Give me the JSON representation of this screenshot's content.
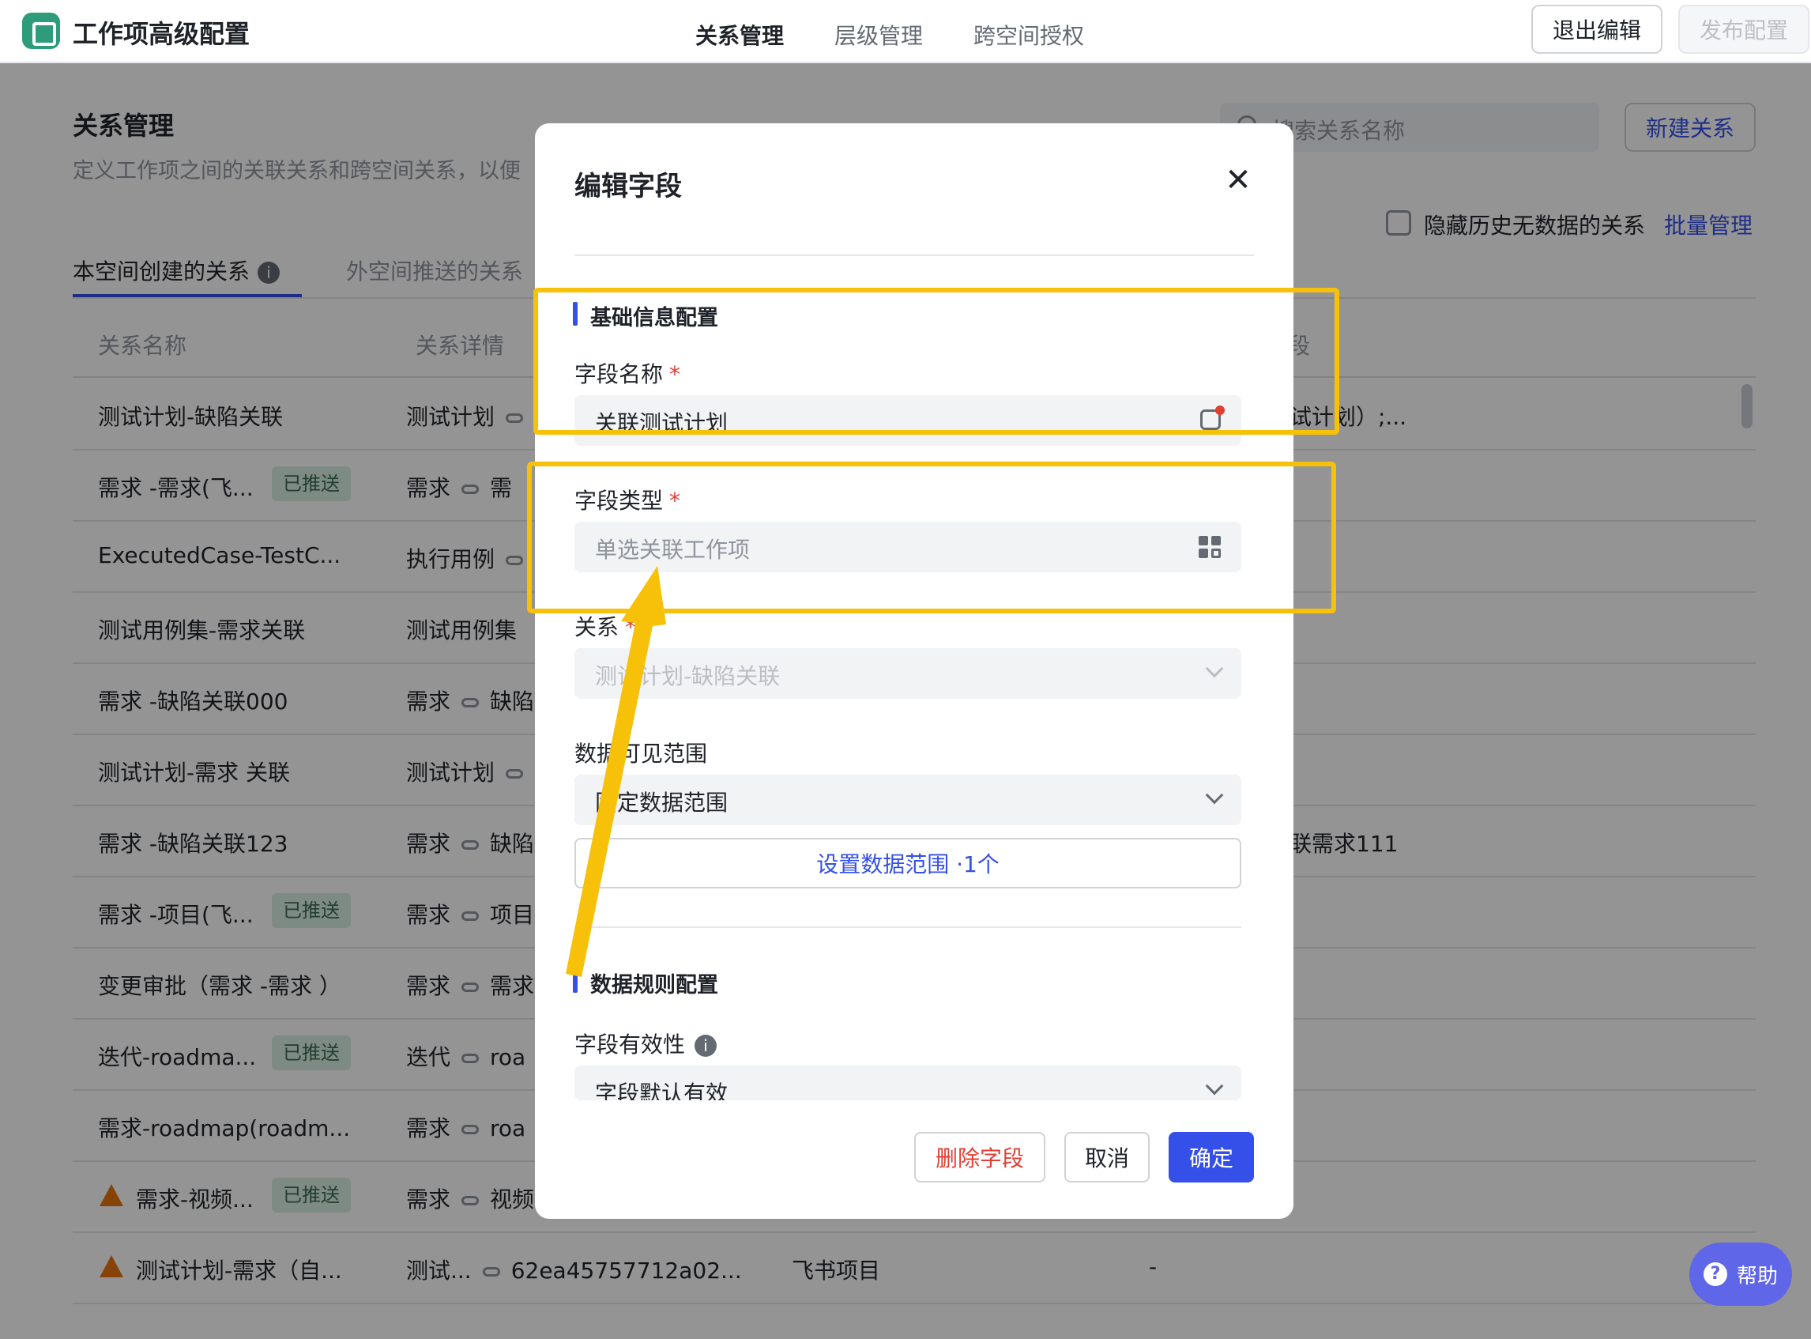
{
  "app": {
    "title": "工作项高级配置"
  },
  "top_tabs": [
    "关系管理",
    "层级管理",
    "跨空间授权"
  ],
  "top_actions": {
    "exit": "退出编辑",
    "publish": "发布配置"
  },
  "page": {
    "title": "关系管理",
    "description": "定义工作项之间的关联关系和跨空间关系，以便",
    "search_placeholder": "搜索关系名称",
    "new_button": "新建关系",
    "hide_label": "隐藏历史无数据的关系",
    "batch": "批量管理",
    "subtabs": [
      "本空间创建的关系",
      "外空间推送的关系"
    ],
    "columns": [
      "关系名称",
      "关系详情",
      "段"
    ]
  },
  "rows": [
    {
      "name": "测试计划-缺陷关联",
      "badge": "",
      "detail": "测试计划",
      "link": true,
      "detail2": "",
      "extra": "试计划）;..."
    },
    {
      "name": "需求 -需求(飞...",
      "badge": "已推送",
      "detail": "需求",
      "link": true,
      "detail2": "需",
      "extra": ""
    },
    {
      "name": "ExecutedCase-TestC...",
      "badge": "",
      "detail": "执行用例",
      "link": true,
      "detail2": "",
      "extra": ""
    },
    {
      "name": "测试用例集-需求关联",
      "badge": "",
      "detail": "测试用例集",
      "link": false,
      "detail2": "",
      "extra": ""
    },
    {
      "name": "需求 -缺陷关联000",
      "badge": "",
      "detail": "需求",
      "link": true,
      "detail2": "缺陷",
      "extra": ""
    },
    {
      "name": "测试计划-需求 关联",
      "badge": "",
      "detail": "测试计划",
      "link": true,
      "detail2": "",
      "extra": ""
    },
    {
      "name": "需求 -缺陷关联123",
      "badge": "",
      "detail": "需求",
      "link": true,
      "detail2": "缺陷",
      "extra": "联需求111"
    },
    {
      "name": "需求 -项目(飞...",
      "badge": "已推送",
      "detail": "需求",
      "link": true,
      "detail2": "项目",
      "extra": ""
    },
    {
      "name": "变更审批（需求 -需求 ）",
      "badge": "",
      "detail": "需求",
      "link": true,
      "detail2": "需求",
      "extra": ""
    },
    {
      "name": "迭代-roadma...",
      "badge": "已推送",
      "detail": "迭代",
      "link": true,
      "detail2": "roa",
      "extra": ""
    },
    {
      "name": "需求-roadmap(roadm...",
      "badge": "",
      "detail": "需求",
      "link": true,
      "detail2": "roa",
      "extra": ""
    },
    {
      "name": "需求-视频...",
      "badge": "已推送",
      "detail": "需求",
      "link": true,
      "detail2": "视频",
      "extra": "",
      "warn": true
    },
    {
      "name": "测试计划-需求（自...",
      "badge": "",
      "detail": "测试...",
      "link": true,
      "detail2": "62ea45757712a02...",
      "extra": "-",
      "warn": true,
      "col3": "飞书项目"
    }
  ],
  "modal": {
    "title": "编辑字段",
    "section_basic": "基础信息配置",
    "field_name_label": "字段名称",
    "field_name_value": "关联测试计划",
    "field_type_label": "字段类型",
    "field_type_value": "单选关联工作项",
    "relation_label": "关系",
    "relation_value": "测试计划-缺陷关联",
    "scope_label": "数据可见范围",
    "scope_value": "固定数据范围",
    "set_scope": "设置数据范围 ·1个",
    "section_rules": "数据规则配置",
    "validity_label": "字段有效性",
    "validity_value": "字段默认有效",
    "required_mark": "*",
    "delete": "删除字段",
    "cancel": "取消",
    "ok": "确定"
  },
  "help": "帮助",
  "colors": {
    "accent": "#3450e8",
    "highlight": "#f7c10a",
    "danger": "#e33e33"
  }
}
